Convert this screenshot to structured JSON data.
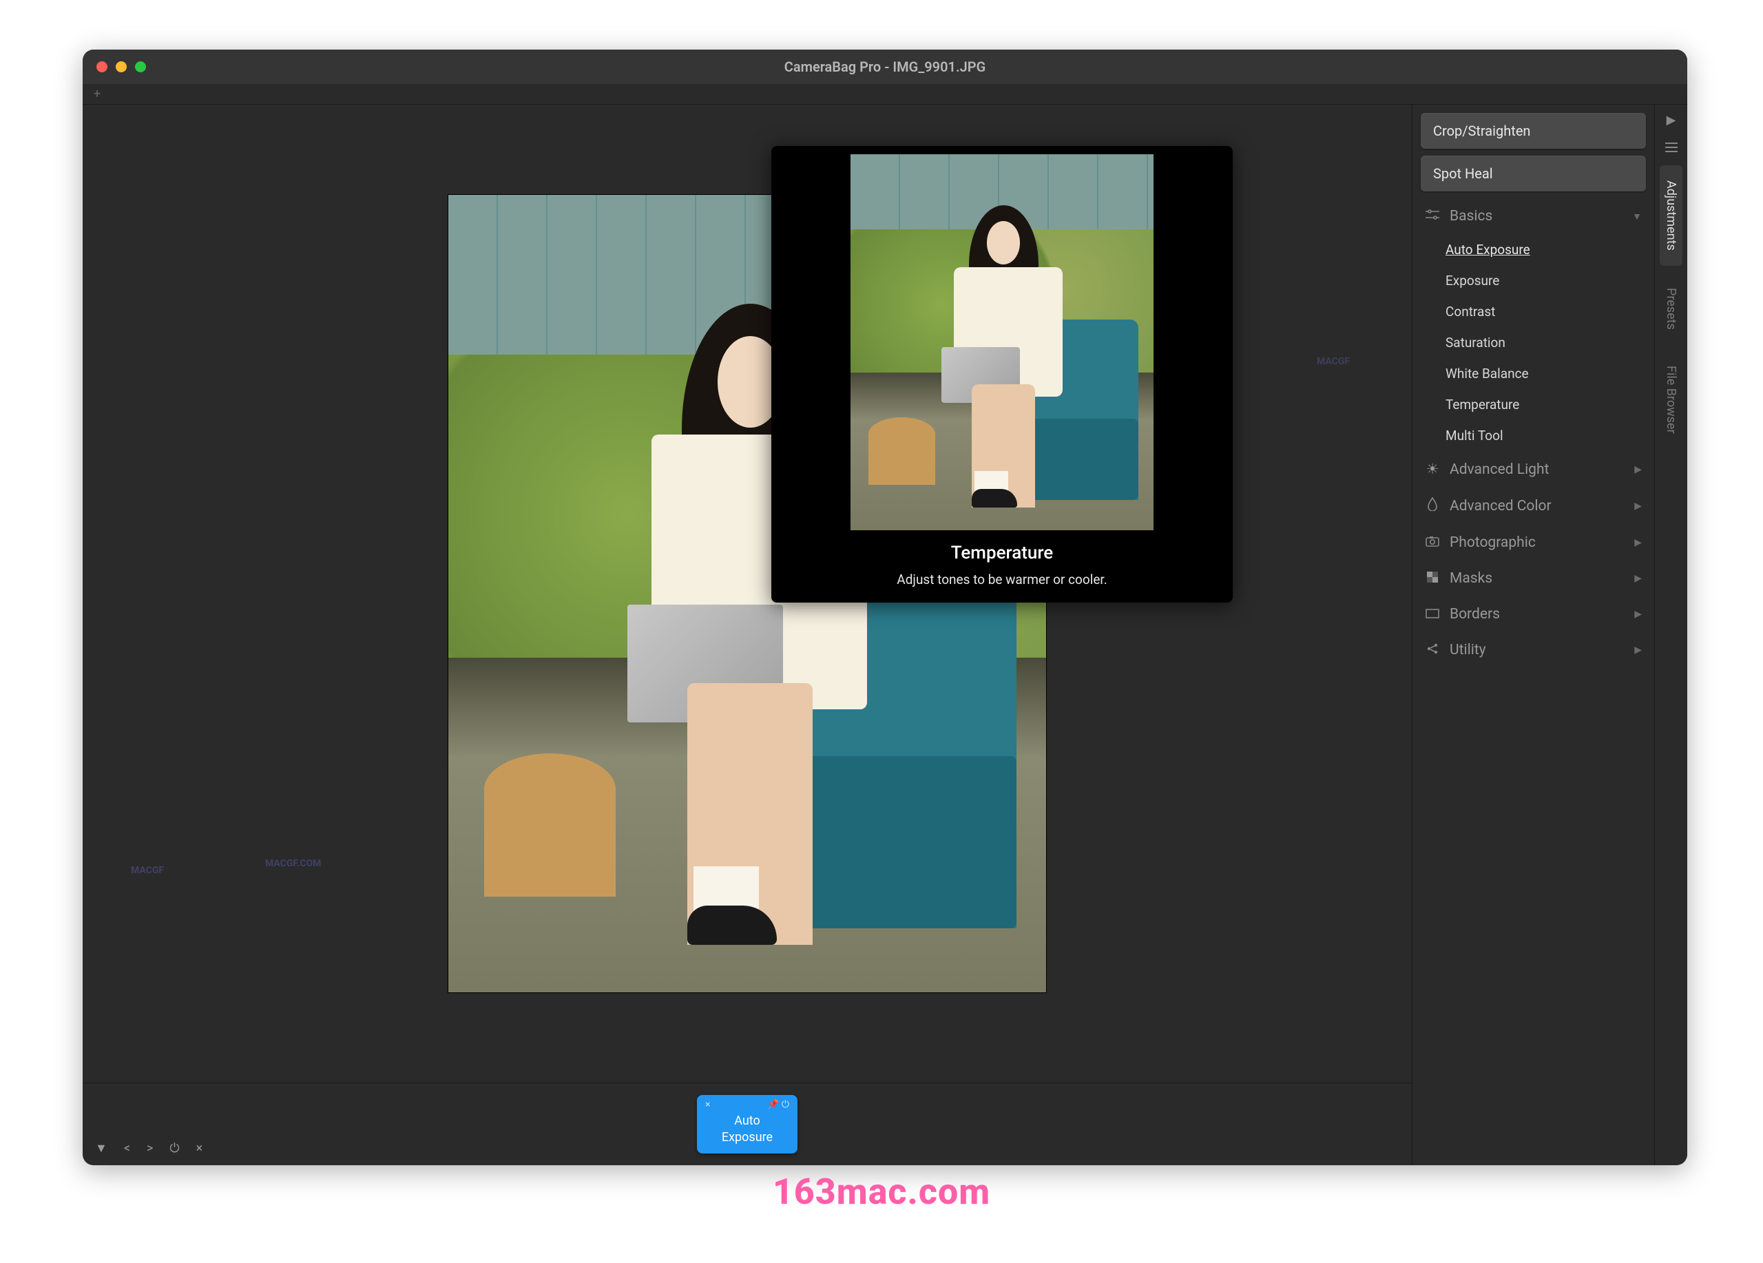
{
  "window": {
    "title": "CameraBag Pro - IMG_9901.JPG"
  },
  "tooltip": {
    "title": "Temperature",
    "desc": "Adjust tones to be warmer or cooler."
  },
  "panel": {
    "crop": "Crop/Straighten",
    "spot": "Spot Heal",
    "basics": {
      "label": "Basics",
      "items": {
        "auto": "Auto Exposure",
        "expo": "Exposure",
        "contrast": "Contrast",
        "sat": "Saturation",
        "wb": "White Balance",
        "temp": "Temperature",
        "multi": "Multi Tool"
      }
    },
    "adv_light": "Advanced Light",
    "adv_color": "Advanced Color",
    "photographic": "Photographic",
    "masks": "Masks",
    "borders": "Borders",
    "utility": "Utility"
  },
  "tabs": {
    "adjustments": "Adjustments",
    "presets": "Presets",
    "file_browser": "File Browser"
  },
  "chip": {
    "label_l1": "Auto",
    "label_l2": "Exposure"
  },
  "watermarks": {
    "w1": "MACGF",
    "w2": "MACGF.COM",
    "w3": "MACGF"
  },
  "footer": "163mac.com"
}
